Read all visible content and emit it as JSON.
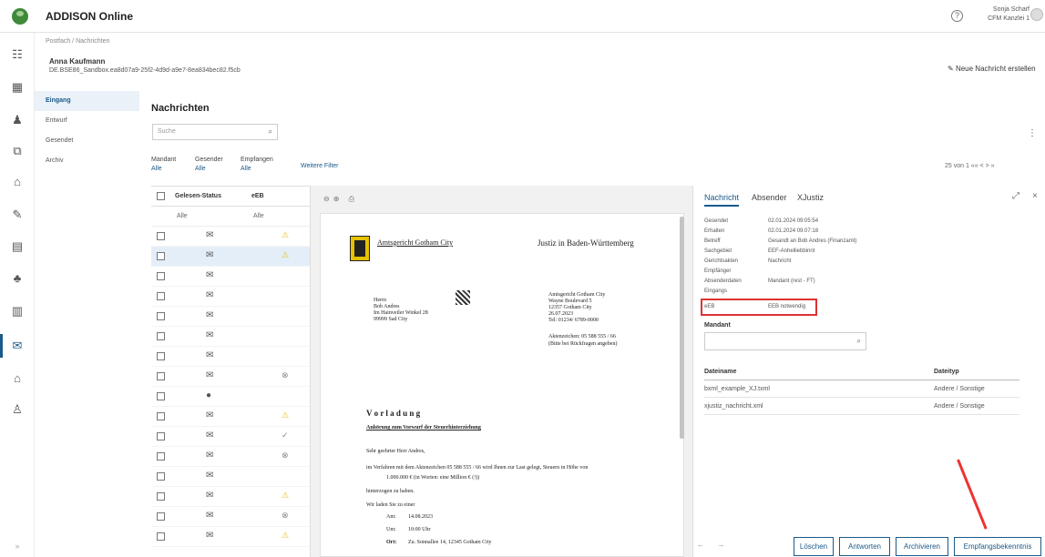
{
  "app": {
    "title": "ADDISON Online",
    "user_name": "Sonja Scharf",
    "user_org": "CFM Kanzlei 1"
  },
  "breadcrumb": "Postfach  /  Nachrichten",
  "client": {
    "name": "Anna Kaufmann",
    "id": "DE.BSE86_Sandbox.ea8d07a9-25f2-4d9d-a9e7-8ea834bec82.f5cb"
  },
  "new_message_label": "Neue Nachricht erstellen",
  "folders": [
    "Eingang",
    "Entwurf",
    "Gesendet",
    "Archiv"
  ],
  "section_title": "Nachrichten",
  "search_placeholder": "Suche",
  "filters": [
    {
      "label": "Mandant",
      "value": "Alle"
    },
    {
      "label": "Gesender",
      "value": "Alle"
    },
    {
      "label": "Empfangen",
      "value": "Alle"
    }
  ],
  "more_filters": "Weitere Filter",
  "pager": "25 von 1 ««  <  >  »",
  "list": {
    "col_status": "Gelesen-Status",
    "col_aek": "eEB",
    "filter_status": "Alle",
    "filter_aek": "Alle"
  },
  "rows": [
    {
      "icon": "✉",
      "flag": "⚠"
    },
    {
      "icon": "✉",
      "flag": "⚠"
    },
    {
      "icon": "✉",
      "flag": ""
    },
    {
      "icon": "✉",
      "flag": ""
    },
    {
      "icon": "✉",
      "flag": ""
    },
    {
      "icon": "✉",
      "flag": ""
    },
    {
      "icon": "✉",
      "flag": ""
    },
    {
      "icon": "✉",
      "flag": "⊗"
    },
    {
      "icon": "●",
      "flag": ""
    },
    {
      "icon": "✉",
      "flag": "⚠"
    },
    {
      "icon": "✉",
      "flag": "✓"
    },
    {
      "icon": "✉",
      "flag": "⊗"
    },
    {
      "icon": "✉",
      "flag": ""
    },
    {
      "icon": "✉",
      "flag": "⚠"
    },
    {
      "icon": "✉",
      "flag": "⊗"
    },
    {
      "icon": "✉",
      "flag": "⚠"
    }
  ],
  "document": {
    "court_header": "Amtsgericht Gotham City",
    "justiz": "Justiz in Baden-Württemberg",
    "recipient": [
      "Herrn",
      "Bob Andres",
      "Im Hainveiler Winkel 28",
      "99999 Sad City"
    ],
    "sender": [
      "Amtsgericht Gotham City",
      "Wayne Boulevard 5",
      "12357 Gotham City",
      "26.07.2023",
      "Tel: 01234/ 6789-0000"
    ],
    "reference": "Aktenzeichen: 05 588 555 / 66",
    "reference_note": "(Bitte bei Rückfragen angeben)",
    "title": "V o r l a d u n g",
    "subtitle": "Anhörung zum Vorwurf der Steuerhinterziehung",
    "salutation": "Sehr geehrter Herr Andres,",
    "body1": "im Verfahren mit dem Aktenzeichen 05 588 555 / 66 wird Ihnen zur Last gelegt, Steuern in Höhe von",
    "body2": "1.000.000 € (in Worten: eine Million € (!))",
    "body3": "hinterzogen zu haben.",
    "body4": "Wir laden Sie zu einer",
    "am_label": "Am:",
    "am_val": "14.08.2023",
    "um_label": "Um:",
    "um_val": "10:00 Uhr",
    "ort_label": "Ort:",
    "ort_val": "Zu. Sonnallee 14, 12345 Gotham City"
  },
  "details": {
    "tabs": [
      "Nachricht",
      "Absender",
      "XJustiz"
    ],
    "rows": [
      {
        "k": "Gesendet",
        "v": "02.01.2024 09:05:54"
      },
      {
        "k": "Erhalten",
        "v": "02.01.2024 09:07:18"
      },
      {
        "k": "Betreff",
        "v": "Gesandt an Bob Andres (Finanzamt)"
      },
      {
        "k": "Sachgebiet",
        "v": "EEF-Anhelliebbinnt"
      },
      {
        "k": "Gerichtsakten",
        "v": "Nachricht"
      },
      {
        "k": "Empfänger",
        "v": ""
      },
      {
        "k": "Absenderdaten",
        "v": "Mandant (rest - FT)"
      },
      {
        "k": "Eingangs",
        "v": ""
      }
    ],
    "eeb_key": "eEB",
    "eeb_val": "EEB notwendig",
    "mandant_label": "Mandant",
    "att_head": [
      "Dateiname",
      "Dateityp"
    ],
    "attachments": [
      {
        "name": "bxml_example_XJ.txml",
        "type": "Andere / Sonstige"
      },
      {
        "name": "xjustiz_nachricht.xml",
        "type": "Andere / Sonstige"
      }
    ],
    "buttons": [
      "Löschen",
      "Antworten",
      "Archivieren",
      "Empfangsbekenntnis"
    ]
  }
}
